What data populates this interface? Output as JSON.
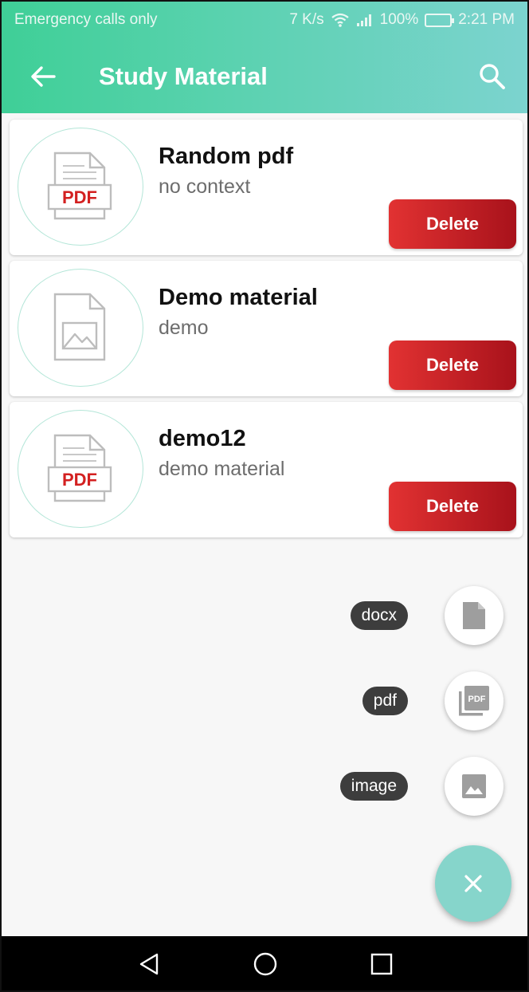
{
  "status_bar": {
    "carrier": "Emergency calls only",
    "speed": "7 K/s",
    "battery": "100%",
    "time": "2:21 PM"
  },
  "app_bar": {
    "title": "Study Material"
  },
  "materials": [
    {
      "title": "Random pdf",
      "subtitle": "no context",
      "type": "pdf",
      "pdf_label": "PDF",
      "delete_label": "Delete"
    },
    {
      "title": "Demo material",
      "subtitle": "demo",
      "type": "image",
      "delete_label": "Delete"
    },
    {
      "title": "demo12",
      "subtitle": "demo material",
      "type": "pdf",
      "pdf_label": "PDF",
      "delete_label": "Delete"
    }
  ],
  "fab_menu": [
    {
      "label": "docx",
      "icon": "document-icon"
    },
    {
      "label": "pdf",
      "icon": "pdf-icon"
    },
    {
      "label": "image",
      "icon": "image-icon"
    }
  ],
  "main_fab": {
    "icon": "close-icon"
  },
  "colors": {
    "accent_start": "#3fcf97",
    "accent_end": "#7cd3cf",
    "delete_start": "#e23232",
    "delete_end": "#a8121b",
    "pdf_red": "#d32020"
  }
}
